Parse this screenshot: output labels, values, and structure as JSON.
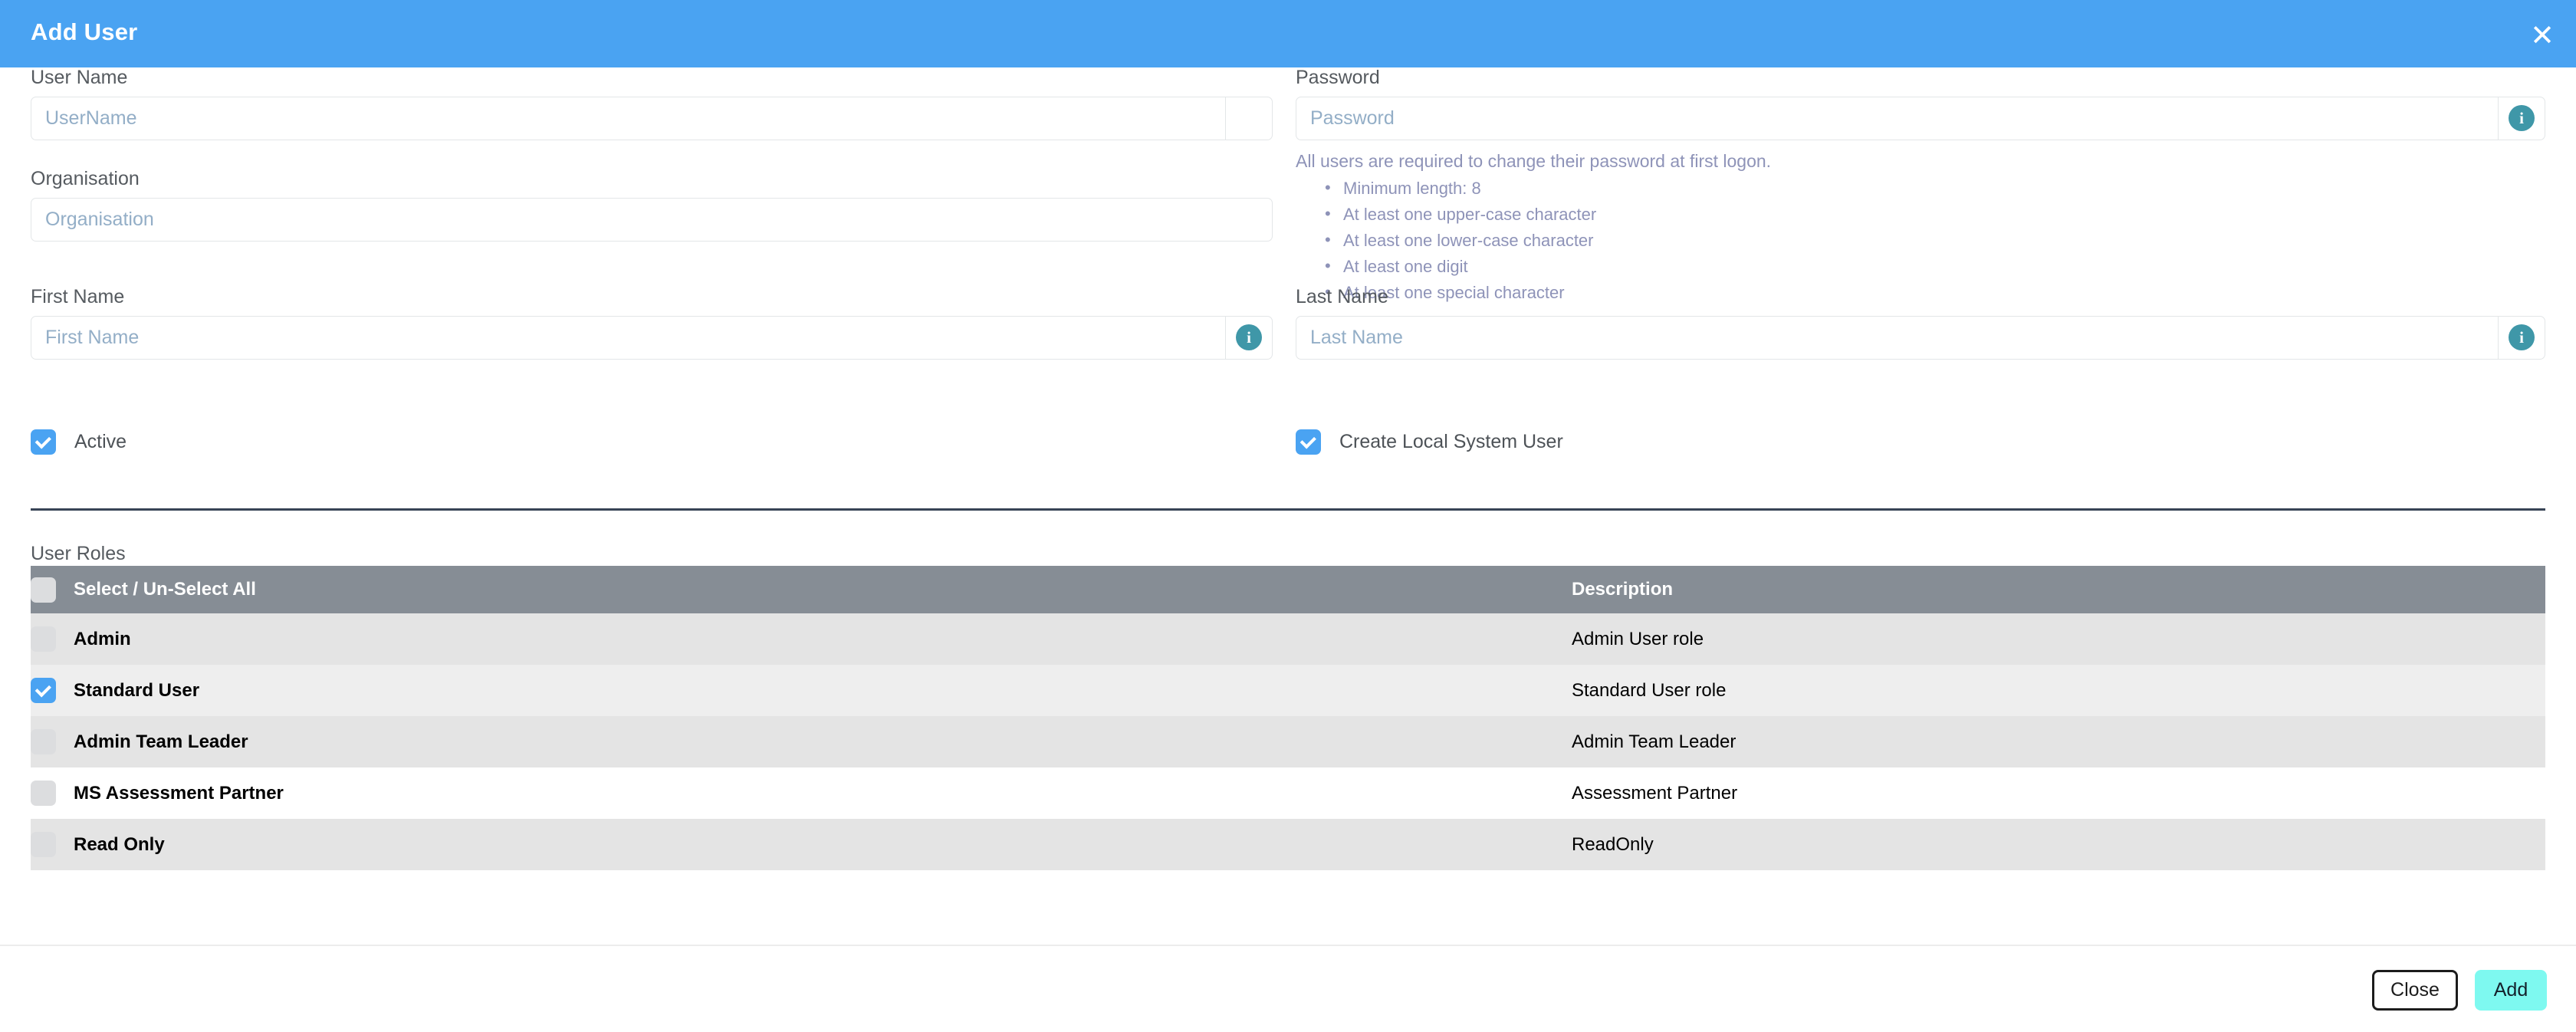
{
  "header": {
    "title": "Add User",
    "close_icon": "close-icon",
    "background": "#4aa3f2"
  },
  "form": {
    "user_name": {
      "label": "User Name",
      "placeholder": "UserName",
      "value": ""
    },
    "password": {
      "label": "Password",
      "placeholder": "Password",
      "value": "",
      "info_icon": "info-icon",
      "hint": "All users are required to change their password at first logon.",
      "requirements": [
        "Minimum length: 8",
        "At least one upper-case character",
        "At least one lower-case character",
        "At least one digit",
        "At least one special character"
      ]
    },
    "organisation": {
      "label": "Organisation",
      "placeholder": "Organisation",
      "value": ""
    },
    "first_name": {
      "label": "First Name",
      "placeholder": "First Name",
      "value": "",
      "info_icon": "info-icon"
    },
    "last_name": {
      "label": "Last Name",
      "placeholder": "Last Name",
      "value": "",
      "info_icon": "info-icon"
    },
    "active": {
      "label": "Active",
      "checked": true
    },
    "create_local_system_user": {
      "label": "Create Local System User",
      "checked": true
    }
  },
  "roles": {
    "section_title": "User Roles",
    "header": {
      "select_all_label": "Select / Un-Select All",
      "select_all_checked": false,
      "description_label": "Description"
    },
    "rows": [
      {
        "name": "Admin",
        "description": "Admin User role",
        "checked": false
      },
      {
        "name": "Standard User",
        "description": "Standard User role",
        "checked": true
      },
      {
        "name": "Admin Team Leader",
        "description": "Admin Team Leader",
        "checked": false
      },
      {
        "name": "MS Assessment Partner",
        "description": "Assessment Partner",
        "checked": false
      },
      {
        "name": "Read Only",
        "description": "ReadOnly",
        "checked": false
      }
    ]
  },
  "footer": {
    "close_label": "Close",
    "add_label": "Add"
  },
  "colors": {
    "header_blue": "#4aa3f2",
    "checkbox_blue": "#4aa3f2",
    "table_header_gray": "#868d95",
    "info_icon_teal": "#3f97a8",
    "add_button_cyan": "#7ef9f0",
    "divider_navy": "#384456"
  }
}
